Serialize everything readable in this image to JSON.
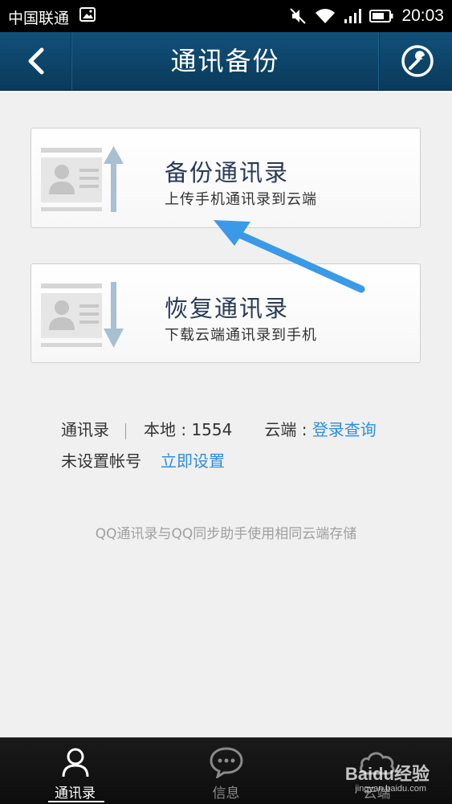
{
  "status_bar": {
    "carrier": "中国联通",
    "time": "20:03",
    "icons": [
      "image-icon",
      "mute-icon",
      "wifi-icon",
      "signal-icon",
      "battery-icon"
    ]
  },
  "header": {
    "title": "通讯备份",
    "left_icon": "back-arrow-icon",
    "right_icon": "wrench-icon"
  },
  "cards": [
    {
      "title": "备份通讯录",
      "subtitle": "上传手机通讯录到云端",
      "icon": "contact-upload-icon"
    },
    {
      "title": "恢复通讯录",
      "subtitle": "下载云端通讯录到手机",
      "icon": "contact-download-icon"
    }
  ],
  "info": {
    "contacts_label": "通讯录",
    "local_label": "本地 : ",
    "local_count": "1554",
    "cloud_label": "云端 : ",
    "cloud_link": "登录查询",
    "account_status": "未设置帐号",
    "setup_link": "立即设置"
  },
  "footnote": "QQ通讯录与QQ同步助手使用相同云端存储",
  "tab_bar": {
    "tabs": [
      {
        "label": "通讯录",
        "icon": "person-icon",
        "active": true
      },
      {
        "label": "信息",
        "icon": "chat-bubble-icon",
        "active": false
      },
      {
        "label": "云端",
        "icon": "cloud-icon",
        "active": false
      }
    ]
  },
  "watermark": {
    "text": "Baidu经验",
    "sub": "jingyan.baidu.com"
  },
  "colors": {
    "header": "#0f4a72",
    "link": "#2f8ed9",
    "annotation_arrow": "#3a9ae8"
  }
}
